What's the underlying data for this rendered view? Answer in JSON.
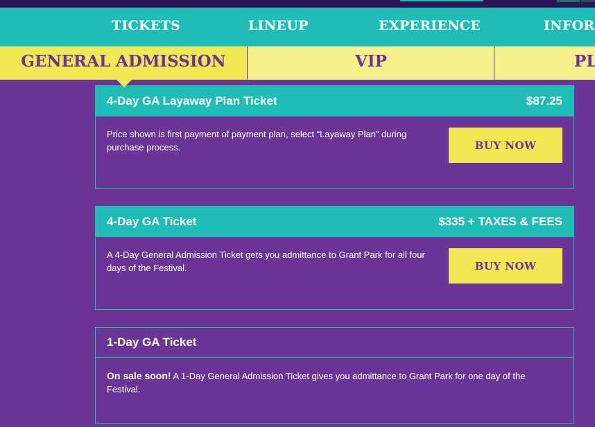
{
  "main_nav": [
    {
      "label": "TICKETS"
    },
    {
      "label": "LINEUP"
    },
    {
      "label": "EXPERIENCE"
    },
    {
      "label": "INFORM"
    }
  ],
  "sub_tabs": [
    {
      "label": "GENERAL ADMISSION",
      "active": true
    },
    {
      "label": "VIP",
      "active": false
    },
    {
      "label": "PLA",
      "active": false
    }
  ],
  "tickets": [
    {
      "title": "4-Day GA Layaway Plan Ticket",
      "price": "$87.25",
      "description": "Price shown is first payment of payment plan, select “Layaway Plan” during purchase process.",
      "button_label": "BUY NOW"
    },
    {
      "title": "4-Day GA Ticket",
      "price": "$335 + TAXES & FEES",
      "description": "A 4-Day General Admission Ticket gets you admittance to Grant Park for all four days of the Festival.",
      "button_label": "BUY NOW"
    },
    {
      "title": "1-Day GA Ticket",
      "price": "",
      "status": "On sale soon!",
      "description": "A 1-Day General Admission Ticket gives you admittance to Grant Park for one day of the Festival."
    }
  ],
  "colors": {
    "background": "#6b3598",
    "teal": "#1fbdb6",
    "yellow": "#f5e653",
    "light_yellow": "#f8f08a"
  }
}
